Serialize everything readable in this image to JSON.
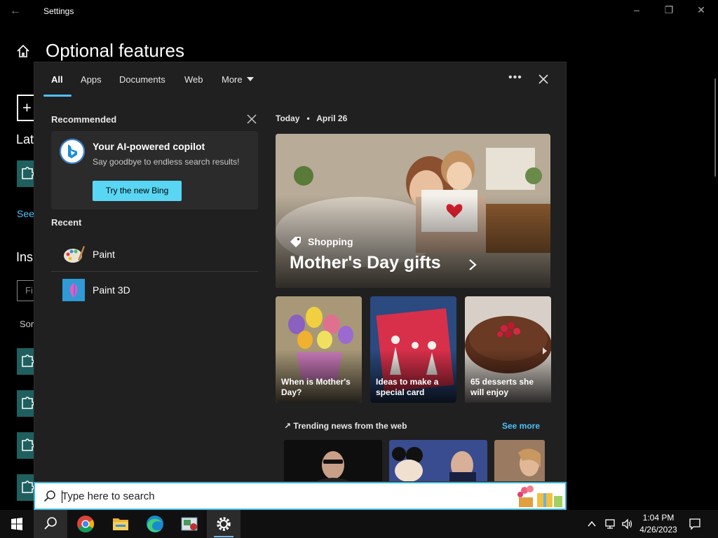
{
  "window": {
    "title": "Settings"
  },
  "settings": {
    "page_title": "Optional features",
    "bg_lat": "Lat",
    "bg_see": "See",
    "bg_ins": "Ins",
    "bg_fi": "Fi",
    "bg_sor": "Sor"
  },
  "search": {
    "tabs": [
      {
        "label": "All"
      },
      {
        "label": "Apps"
      },
      {
        "label": "Documents"
      },
      {
        "label": "Web"
      },
      {
        "label": "More"
      }
    ],
    "recommended": {
      "heading": "Recommended",
      "card_title": "Your AI-powered copilot",
      "card_subtitle": "Say goodbye to endless search results!",
      "card_button": "Try the new Bing"
    },
    "recent": {
      "heading": "Recent",
      "items": [
        {
          "name": "Paint",
          "icon": "paint-icon"
        },
        {
          "name": "Paint 3D",
          "icon": "paint-3d-icon"
        }
      ]
    },
    "today": {
      "label": "Today",
      "date": "April 26"
    },
    "hero": {
      "category": "Shopping",
      "headline": "Mother's Day gifts"
    },
    "cards": [
      {
        "caption": "When is Mother's Day?"
      },
      {
        "caption": "Ideas to make a special card"
      },
      {
        "caption": "65 desserts she will enjoy"
      }
    ],
    "trending": {
      "heading": "Trending news from the web",
      "see_more": "See more"
    },
    "input": {
      "placeholder": "Type here to search"
    }
  },
  "taskbar": {
    "clock": {
      "time": "1:04 PM",
      "date": "4/26/2023"
    }
  },
  "colors": {
    "accent": "#4cc2ff",
    "bing_button": "#59d6f3",
    "search_border": "#42b6d6"
  }
}
